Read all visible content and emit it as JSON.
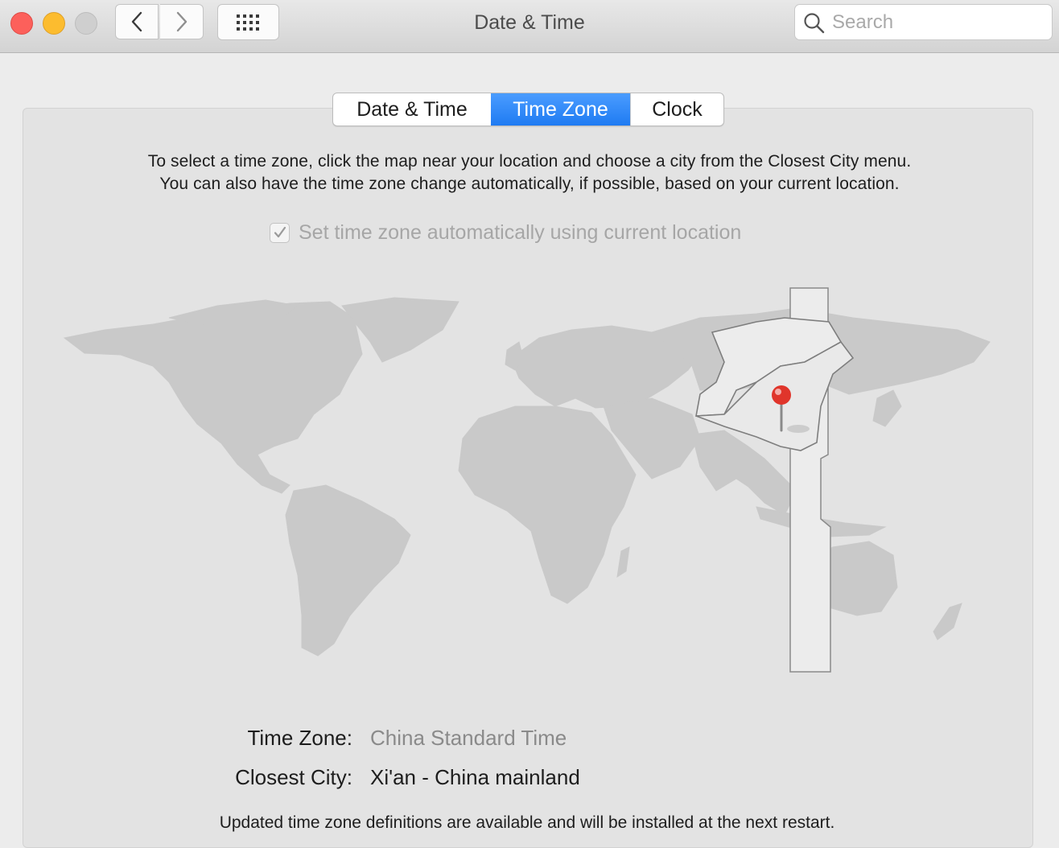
{
  "window": {
    "title": "Date & Time"
  },
  "toolbar": {
    "search_placeholder": "Search"
  },
  "tabs": [
    {
      "label": "Date & Time",
      "active": false
    },
    {
      "label": "Time Zone",
      "active": true
    },
    {
      "label": "Clock",
      "active": false
    }
  ],
  "instructions": {
    "line1": "To select a time zone, click the map near your location and choose a city from the Closest City menu.",
    "line2": "You can also have the time zone change automatically, if possible, based on your current location."
  },
  "auto_timezone": {
    "label": "Set time zone automatically using current location",
    "checked": true,
    "enabled": false
  },
  "time_zone": {
    "label": "Time Zone:",
    "value": "China Standard Time"
  },
  "closest_city": {
    "label": "Closest City:",
    "value": "Xi'an - China mainland"
  },
  "footer": {
    "text": "Updated time zone definitions are available and will be installed at the next restart."
  },
  "colors": {
    "accent": "#1f7bf2",
    "pin": "#e0352b",
    "land": "#c9c9c9",
    "highlight": "#ececec"
  }
}
